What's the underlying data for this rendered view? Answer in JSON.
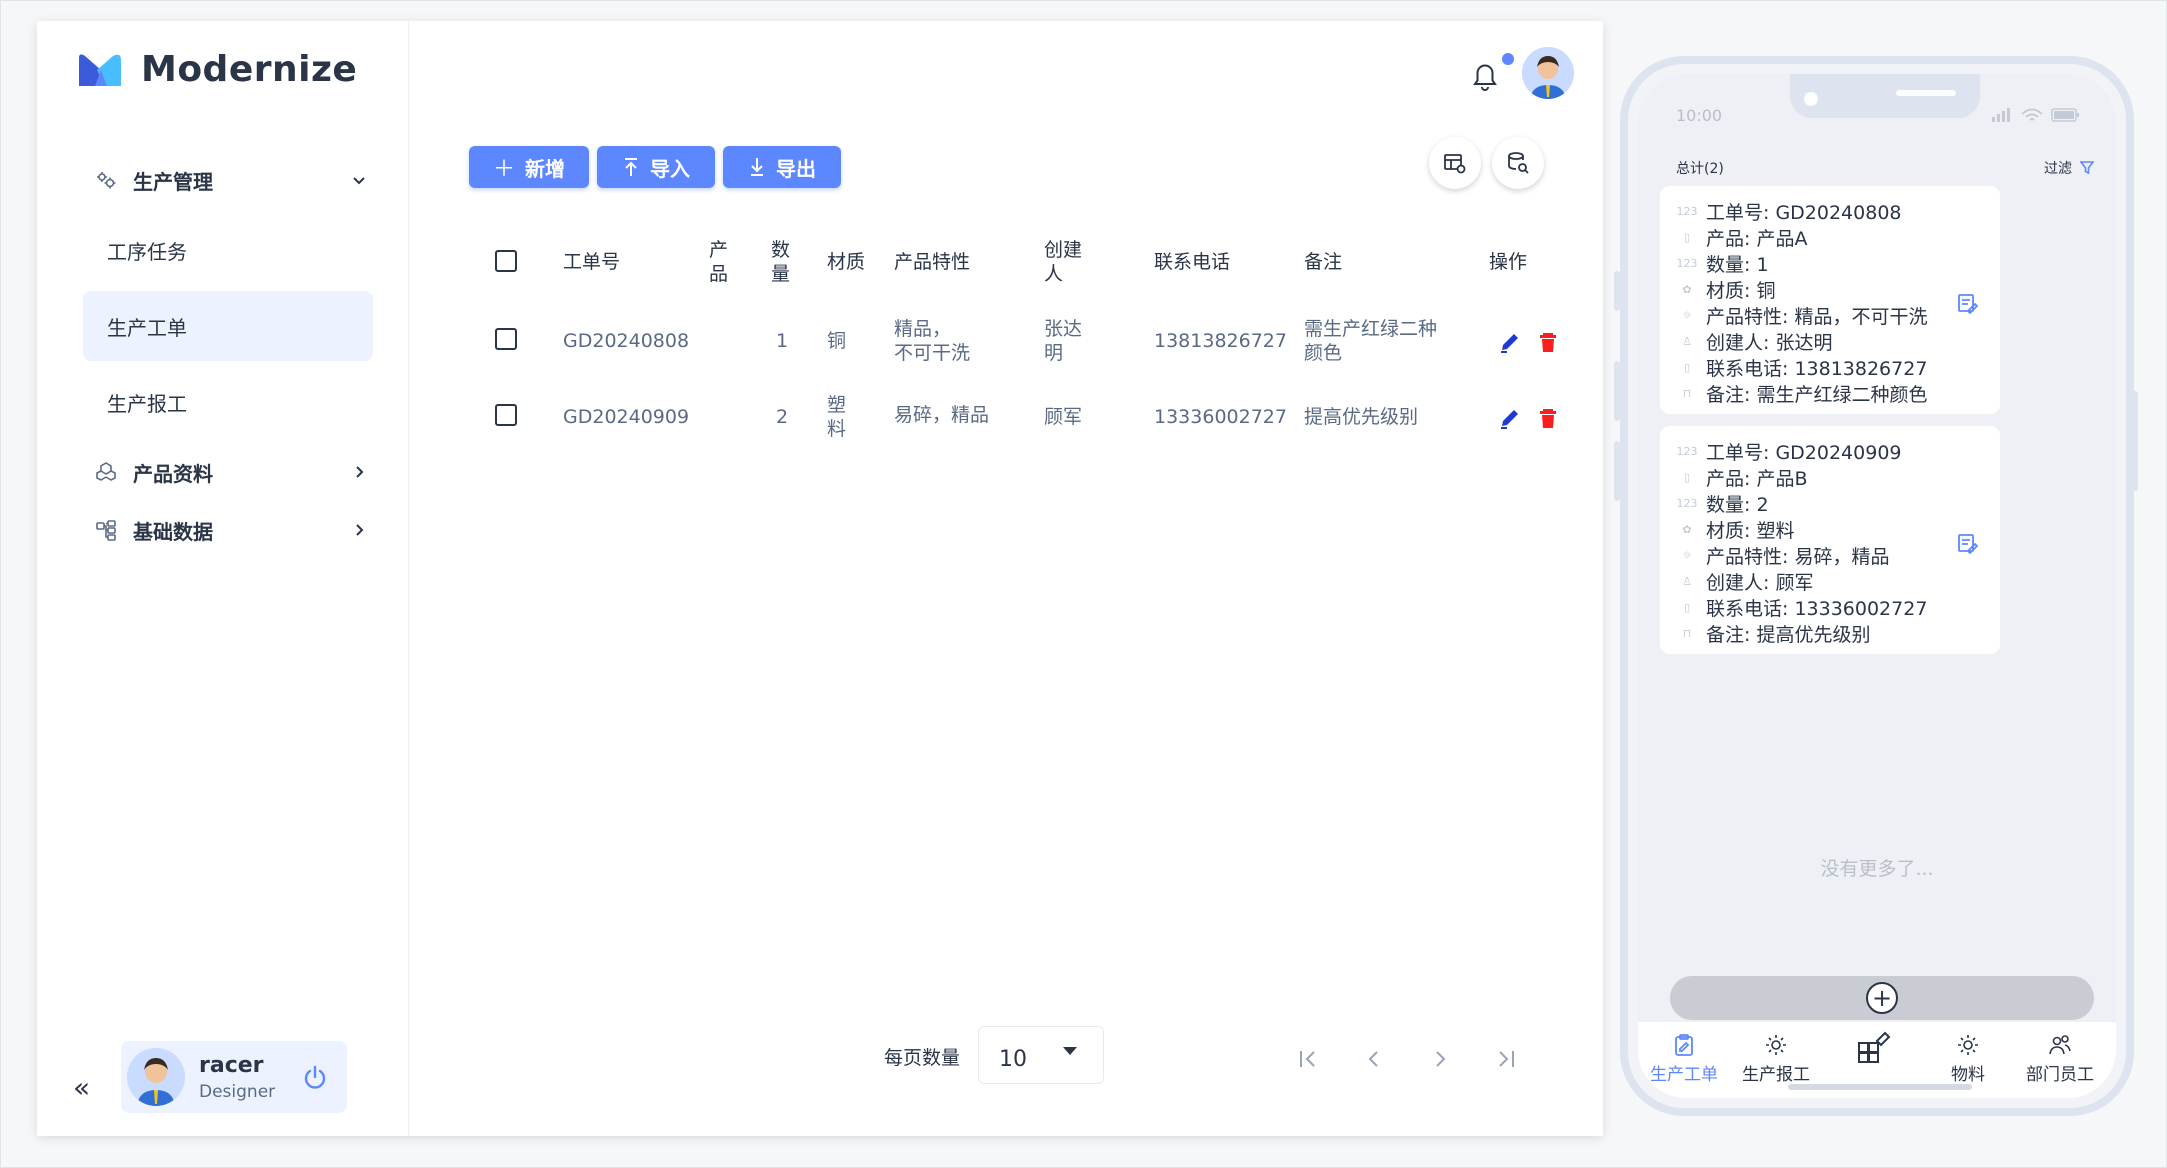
{
  "brand": {
    "name": "Modernize",
    "colors": {
      "primary": "#5d87ff",
      "danger": "#fa1e1e",
      "text": "#2a3547"
    }
  },
  "sidebar": {
    "groups": [
      {
        "label": "生产管理",
        "icon": "settings-icon",
        "expanded": true,
        "items": [
          {
            "label": "工序任务",
            "active": false
          },
          {
            "label": "生产工单",
            "active": true
          },
          {
            "label": "生产报工",
            "active": false
          }
        ]
      },
      {
        "label": "产品资料",
        "icon": "cubes-icon",
        "expanded": false
      },
      {
        "label": "基础数据",
        "icon": "tree-structure-icon",
        "expanded": false
      }
    ],
    "profile": {
      "name": "racer",
      "role": "Designer"
    },
    "collapse_label": "«"
  },
  "toolbar": {
    "add_label": "新增",
    "import_label": "导入",
    "export_label": "导出"
  },
  "table": {
    "headers": [
      "工单号",
      "产品",
      "数量",
      "材质",
      "产品特性",
      "创建人",
      "联系电话",
      "备注",
      "操作"
    ],
    "rows": [
      {
        "order_no": "GD20240808",
        "qty": "1",
        "material": "铜",
        "features": "精品，\n不可干洗",
        "creator": "张达\n明",
        "phone": "13813826727",
        "remark": "需生产红绿二种\n颜色"
      },
      {
        "order_no": "GD20240909",
        "qty": "2",
        "material": "塑\n料",
        "features": "易碎，精品",
        "creator": "顾军",
        "phone": "13336002727",
        "remark": "提高优先级别"
      }
    ]
  },
  "pagination": {
    "label": "每页数量",
    "page_size": "10"
  },
  "phone": {
    "status_time": "10:00",
    "total_label": "总计(2)",
    "filter_label": "过滤",
    "cards": [
      {
        "lines": [
          "工单号: GD20240808",
          "产品: 产品A",
          "数量: 1",
          "材质: 铜",
          "产品特性: 精品，不可干洗",
          "创建人: 张达明",
          "联系电话: 13813826727",
          "备注: 需生产红绿二种颜色"
        ]
      },
      {
        "lines": [
          "工单号: GD20240909",
          "产品: 产品B",
          "数量: 2",
          "材质: 塑料",
          "产品特性: 易碎，精品",
          "创建人: 顾军",
          "联系电话: 13336002727",
          "备注: 提高优先级别"
        ]
      }
    ],
    "no_more": "没有更多了...",
    "tabs": [
      "生产工单",
      "生产报工",
      "",
      "物料",
      "部门员工"
    ]
  }
}
